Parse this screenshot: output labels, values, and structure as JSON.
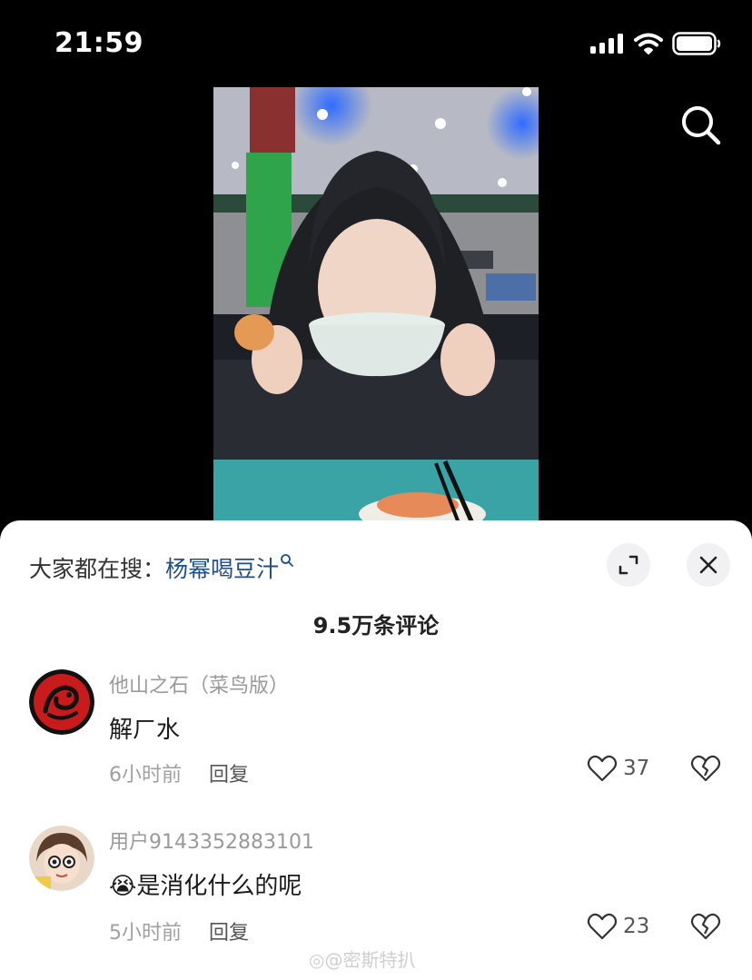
{
  "status": {
    "time": "21:59"
  },
  "sheet": {
    "search_prefix": "大家都在搜：",
    "search_keyword": "杨幂喝豆汁",
    "comment_count": "9.5万条评论"
  },
  "comments": [
    {
      "user": "他山之石（菜鸟版）",
      "text": "解ㄏ水",
      "time": "6小时前",
      "reply": "回复",
      "likes": "37"
    },
    {
      "user": "用户9143352883101",
      "text": "😭是消化什么的呢",
      "time": "5小时前",
      "reply": "回复",
      "likes": "23"
    }
  ],
  "watermark": "◎@密斯特扒",
  "icons": [
    "search-icon",
    "expand-icon",
    "close-icon",
    "heart-icon",
    "broken-heart-icon",
    "signal-icon",
    "wifi-icon",
    "battery-icon"
  ]
}
